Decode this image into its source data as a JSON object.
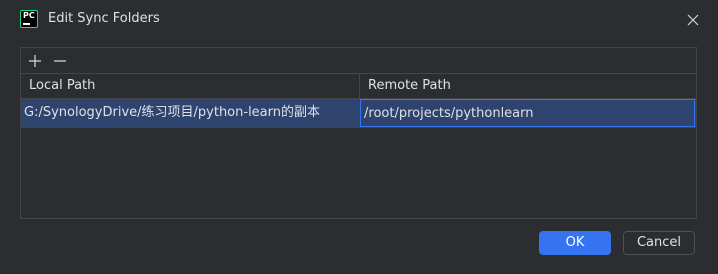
{
  "window": {
    "title": "Edit Sync Folders",
    "app_icon": "pycharm-icon",
    "app_icon_text": "PC"
  },
  "toolbar": {
    "add_icon": "plus-icon",
    "remove_icon": "minus-icon"
  },
  "table": {
    "columns": [
      "Local Path",
      "Remote Path"
    ],
    "rows": [
      {
        "local_path": "G:/SynologyDrive/练习项目/python-learn的副本",
        "remote_path": "/root/projects/pythonlearn"
      }
    ]
  },
  "buttons": {
    "ok_label": "OK",
    "cancel_label": "Cancel"
  },
  "colors": {
    "background": "#2b2d30",
    "selection": "#2e436e",
    "accent": "#3574f0",
    "border": "#43454a",
    "text": "#dfe1e5"
  }
}
